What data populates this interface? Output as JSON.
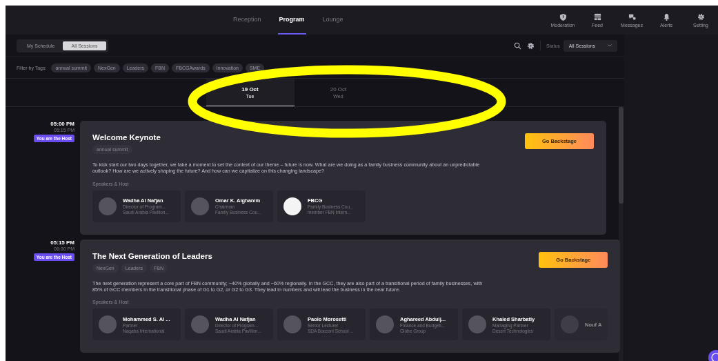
{
  "header": {
    "tabs": [
      {
        "label": "Reception",
        "selected": false
      },
      {
        "label": "Program",
        "selected": true
      },
      {
        "label": "Lounge",
        "selected": false
      }
    ],
    "actions": [
      {
        "label": "Moderation",
        "kind": "shield"
      },
      {
        "label": "Feed",
        "kind": "feed"
      },
      {
        "label": "Messages",
        "kind": "messages"
      },
      {
        "label": "Alerts",
        "kind": "bell"
      },
      {
        "label": "Setting",
        "kind": "gear"
      }
    ]
  },
  "schedule_toggle": [
    {
      "label": "My Schedule",
      "selected": false
    },
    {
      "label": "All Sessions",
      "selected": true
    }
  ],
  "status": {
    "label": "Status",
    "value": "All Sessions"
  },
  "filter": {
    "label": "Filter by Tags:",
    "tags": [
      "annual summit",
      "NexGen",
      "Leaders",
      "FBN",
      "FBCGAwards",
      "Innovation",
      "SME"
    ]
  },
  "days": [
    {
      "date": "19 Oct",
      "weekday": "Tue",
      "selected": true
    },
    {
      "date": "20 Oct",
      "weekday": "Wed",
      "selected": false
    }
  ],
  "sessions": [
    {
      "start": "05:00 PM",
      "end": "05:15 PM",
      "host_badge": "You are the Host",
      "title": "Welcome Keynote",
      "tags": [
        "annual summit"
      ],
      "description": "To kick start our two days together, we take a moment to set the context of our theme – future is now. What are we doing as a family business community about an unpredictable outlook? How are we actively shaping the future? And how can we capitalize on this changing landscape?",
      "speakers_label": "Speakers & Host",
      "button": "Go Backstage",
      "speakers": [
        {
          "name": "Wadha Al Nafjan",
          "line1": "Director of Program...",
          "line2": "Saudi Arabia Pavilion...",
          "kind": "photo",
          "faded": false
        },
        {
          "name": "Omar K. Alghanim",
          "line1": "Chairman",
          "line2": "Family Business Cou...",
          "kind": "photo",
          "faded": false
        },
        {
          "name": "FBCG",
          "line1": "Family Business Cou...",
          "line2": "member FBN Intern...",
          "kind": "logo",
          "faded": false
        }
      ]
    },
    {
      "start": "05:15 PM",
      "end": "06:00 PM",
      "host_badge": "You are the Host",
      "title": "The Next Generation of Leaders",
      "tags": [
        "NexGen",
        "Leaders",
        "FBN"
      ],
      "description": "The next generation represent a core part of FBN community; ~40% globally and ~60% regionally. In the GCC, they are also part of a transitional period of family businesses, with 85% of GCC members in the transitional phase of G1 to G2, or G2 to G3. They lead in numbers and will lead the business in the near future.",
      "speakers_label": "Speakers & Host",
      "button": "Go Backstage",
      "speakers": [
        {
          "name": "Mohammed S. Al ...",
          "line1": "Partner",
          "line2": "Naqaba International",
          "kind": "photo",
          "faded": false
        },
        {
          "name": "Wadha Al Nafjan",
          "line1": "Director of Program...",
          "line2": "Saudi Arabia Pavilion...",
          "kind": "photo",
          "faded": false
        },
        {
          "name": "Paolo Morosetti",
          "line1": "Senior Lecturer",
          "line2": "SDA Bocconi School ...",
          "kind": "photo",
          "faded": false
        },
        {
          "name": "Aghareed Abdulj...",
          "line1": "Finance and Budgeti...",
          "line2": "Globe Group",
          "kind": "photo",
          "faded": false
        },
        {
          "name": "Khaled Sharbatly",
          "line1": "Managing Partner",
          "line2": "Desert Technologies",
          "kind": "photo",
          "faded": false
        },
        {
          "name": "Nouf A",
          "kind": "photo",
          "faded": true
        }
      ]
    }
  ]
}
